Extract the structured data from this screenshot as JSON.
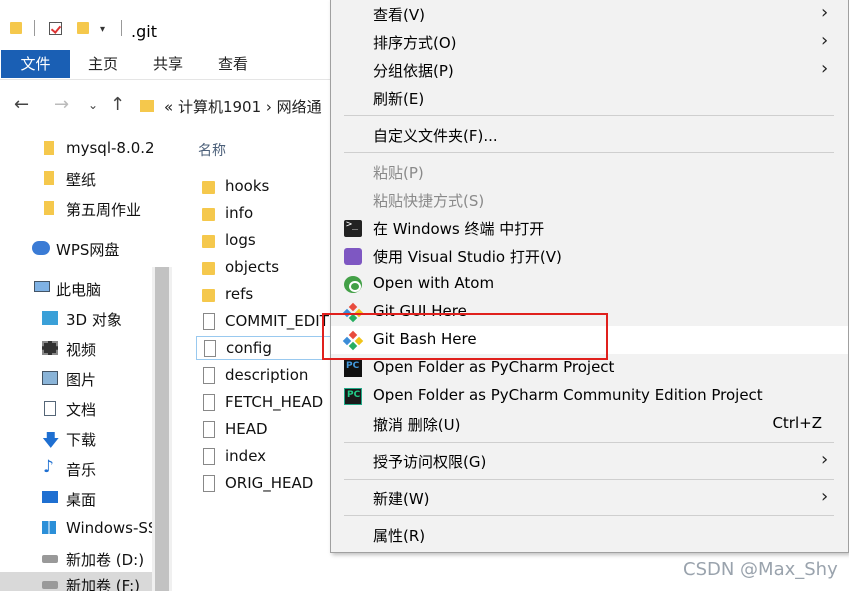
{
  "window": {
    "title": ".git"
  },
  "ribbon": {
    "tabs": [
      "文件",
      "主页",
      "共享",
      "查看"
    ]
  },
  "address": {
    "path": "«  计算机1901  ›  网络通"
  },
  "sidebar": {
    "items": [
      "mysql-8.0.2",
      "壁纸",
      "第五周作业",
      "WPS网盘",
      "此电脑",
      "3D 对象",
      "视频",
      "图片",
      "文档",
      "下载",
      "音乐",
      "桌面",
      "Windows-SS",
      "新加卷 (D:)",
      "新加卷 (F:)"
    ]
  },
  "filelist": {
    "column_header": "名称",
    "files": [
      "hooks",
      "info",
      "logs",
      "objects",
      "refs",
      "COMMIT_EDIT",
      "config",
      "description",
      "FETCH_HEAD",
      "HEAD",
      "index",
      "ORIG_HEAD"
    ]
  },
  "context_menu": {
    "view": "查看(V)",
    "sort_by": "排序方式(O)",
    "group_by": "分组依据(P)",
    "refresh": "刷新(E)",
    "customize_folder": "自定义文件夹(F)...",
    "paste": "粘贴(P)",
    "paste_shortcut": "粘贴快捷方式(S)",
    "open_windows_terminal": "在 Windows 终端 中打开",
    "open_visual_studio": "使用 Visual Studio 打开(V)",
    "open_with_atom": "Open with Atom",
    "git_gui_here": "Git GUI Here",
    "git_bash_here": "Git Bash Here",
    "open_pycharm": "Open Folder as PyCharm Project",
    "open_pycharm_ce": "Open Folder as PyCharm Community Edition Project",
    "undo_delete": "撤消 删除(U)",
    "undo_shortcut": "Ctrl+Z",
    "grant_access": "授予访问权限(G)",
    "new": "新建(W)",
    "properties": "属性(R)"
  },
  "watermark": "CSDN @Max_Shy",
  "colors": {
    "accent": "#1a5fb4",
    "highlight_border": "#e0201d"
  }
}
